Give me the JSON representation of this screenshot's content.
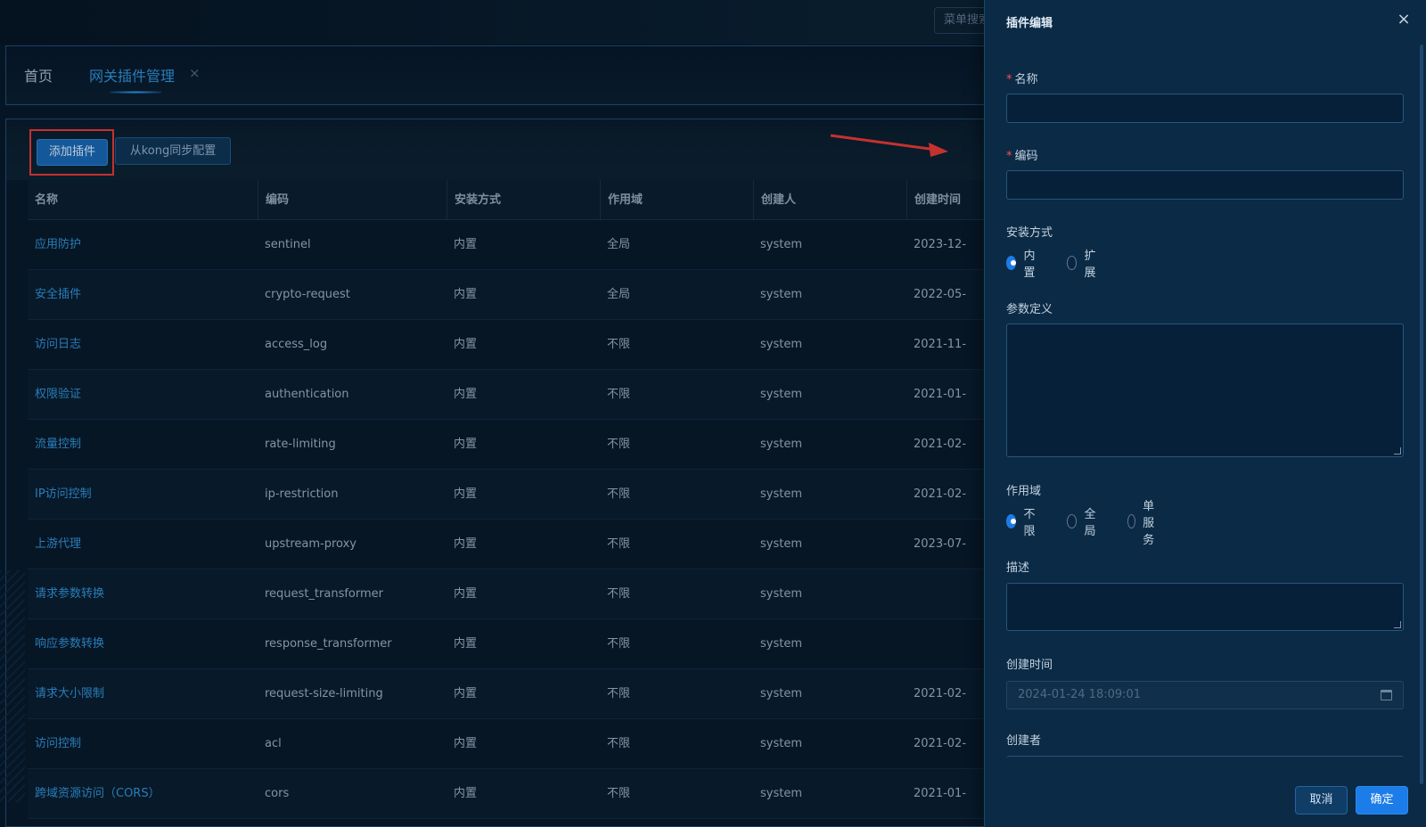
{
  "header": {
    "menu_search_placeholder": "菜单搜索"
  },
  "tabs": [
    {
      "label": "首页"
    },
    {
      "label": "网关插件管理"
    }
  ],
  "tab_close_glyph": "×",
  "toolbar": {
    "add_label": "添加插件",
    "sync_label": "从kong同步配置"
  },
  "table": {
    "columns": [
      "名称",
      "编码",
      "安装方式",
      "作用域",
      "创建人",
      "创建时间"
    ],
    "rows": [
      [
        "应用防护",
        "sentinel",
        "内置",
        "全局",
        "system",
        "2023-12-"
      ],
      [
        "安全插件",
        "crypto-request",
        "内置",
        "全局",
        "system",
        "2022-05-"
      ],
      [
        "访问日志",
        "access_log",
        "内置",
        "不限",
        "system",
        "2021-11-"
      ],
      [
        "权限验证",
        "authentication",
        "内置",
        "不限",
        "system",
        "2021-01-"
      ],
      [
        "流量控制",
        "rate-limiting",
        "内置",
        "不限",
        "system",
        "2021-02-"
      ],
      [
        "IP访问控制",
        "ip-restriction",
        "内置",
        "不限",
        "system",
        "2021-02-"
      ],
      [
        "上游代理",
        "upstream-proxy",
        "内置",
        "不限",
        "system",
        "2023-07-"
      ],
      [
        "请求参数转换",
        "request_transformer",
        "内置",
        "不限",
        "system",
        ""
      ],
      [
        "响应参数转换",
        "response_transformer",
        "内置",
        "不限",
        "system",
        ""
      ],
      [
        "请求大小限制",
        "request-size-limiting",
        "内置",
        "不限",
        "system",
        "2021-02-"
      ],
      [
        "访问控制",
        "acl",
        "内置",
        "不限",
        "system",
        "2021-02-"
      ],
      [
        "跨域资源访问（CORS）",
        "cors",
        "内置",
        "不限",
        "system",
        "2021-01-"
      ]
    ]
  },
  "drawer": {
    "title": "插件编辑",
    "close_glyph": "×",
    "required_mark": "*",
    "fields": {
      "name_label": "名称",
      "code_label": "编码",
      "install_label": "安装方式",
      "install_options": [
        "内置",
        "扩展"
      ],
      "params_label": "参数定义",
      "scope_label": "作用域",
      "scope_options": [
        "不限",
        "全局",
        "单服务"
      ],
      "desc_label": "描述",
      "created_time_label": "创建时间",
      "created_time_value": "2024-01-24 18:09:01",
      "creator_label": "创建者"
    },
    "cancel_label": "取消",
    "ok_label": "确定"
  },
  "colors": {
    "accent": "#1c7de8",
    "link": "#2f8fd2",
    "highlight_box": "#e03a36",
    "required": "#ff4d4f"
  }
}
